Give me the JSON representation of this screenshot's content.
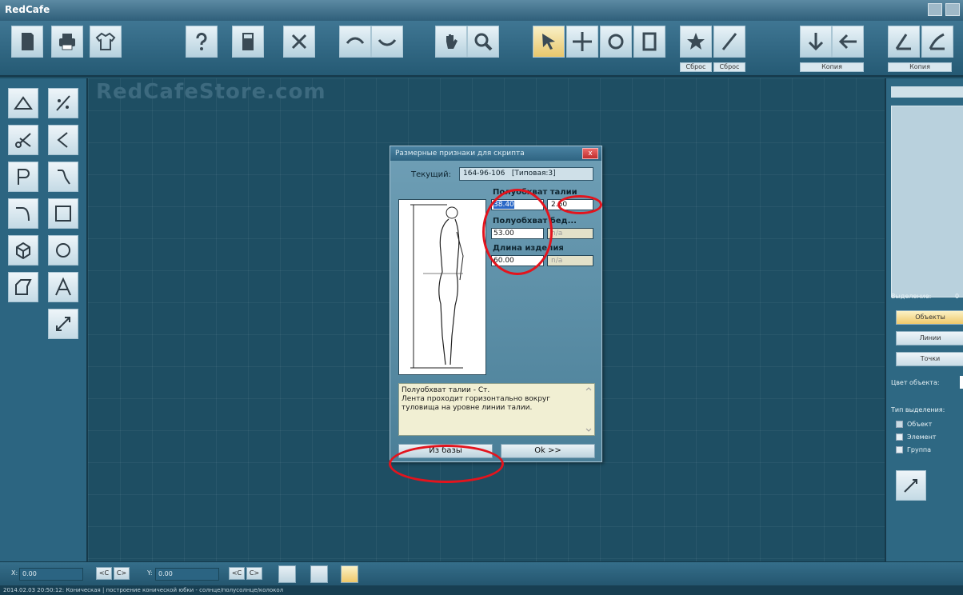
{
  "window": {
    "title": "RedCafe"
  },
  "toolbar": {
    "captions": [
      "Сброс",
      "Сброс",
      "Копия",
      "Копия"
    ]
  },
  "canvas": {
    "watermark": "RedCafeStore.com"
  },
  "dialog": {
    "title": "Размерные признаки для скрипта",
    "close_label": "x",
    "current_label": "Текущий:",
    "current_value": "164-96-106   [Типовая:3]",
    "params": [
      {
        "label": "Полуобхват талии",
        "value": "38.40",
        "value_selected": "38.40",
        "extra": "2.50"
      },
      {
        "label": "Полуобхват бед...",
        "value": "53.00",
        "extra": "n/a"
      },
      {
        "label": "Длина изделия",
        "value": "60.00",
        "extra": "n/a"
      }
    ],
    "description": "Полуобхват талии - Ст.\nЛента проходит горизонтально вокруг туловища на уровне линии талии.",
    "buttons": {
      "from_base": "Из базы",
      "ok": "Ok >>"
    }
  },
  "right_panel": {
    "selection_label": "Выделение:",
    "selection_count": "0",
    "mode_buttons": [
      "Объекты",
      "Линии",
      "Точки"
    ],
    "color_label": "Цвет объекта:",
    "selection_type_label": "Тип выделения:",
    "selection_types": [
      "Объект",
      "Элемент",
      "Группа"
    ]
  },
  "statusbar": {
    "x_label": "X:",
    "x_value": "0.00",
    "y_label": "Y:",
    "y_value": "0.00",
    "prev_label": "<C",
    "next_label": "C>",
    "log": "2014.02.03 20:50:12: Коническая | построение конической юбки - солнце/полусолнце/колокол"
  },
  "colors": {
    "canvas": "#1e4e63",
    "accent": "#efc96b",
    "annotation": "#e3141d"
  }
}
